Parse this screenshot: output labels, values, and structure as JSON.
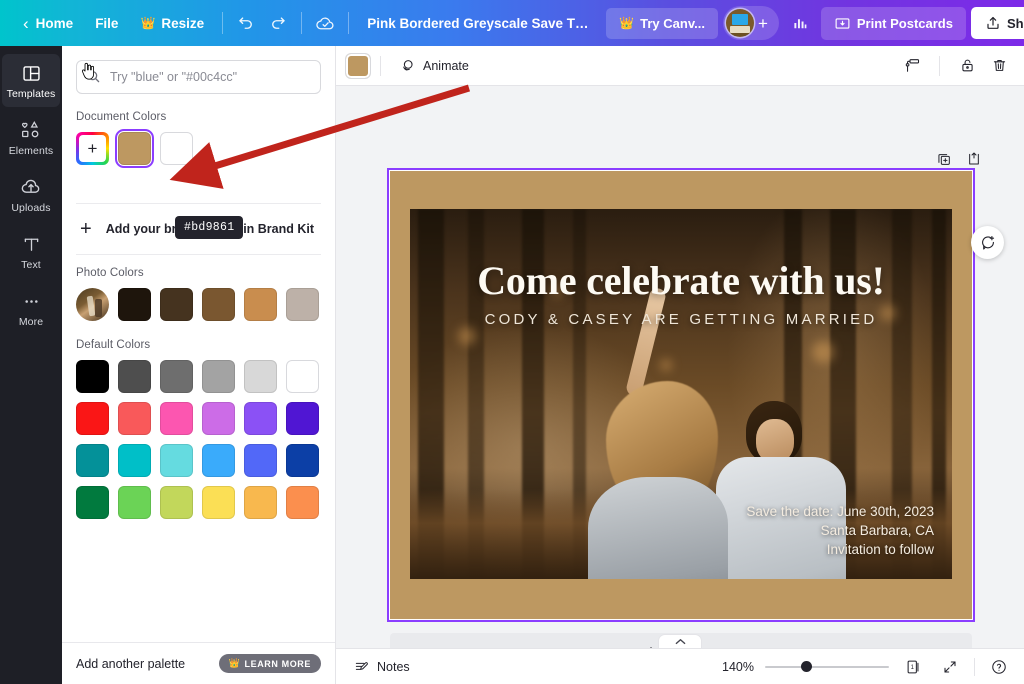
{
  "topbar": {
    "back_icon": "chevron-left-icon",
    "home_label": "Home",
    "file_label": "File",
    "resize_label": "Resize",
    "resize_icon": "crown-icon",
    "undo_icon": "undo-icon",
    "redo_icon": "redo-icon",
    "cloud_icon": "cloud-saved-icon",
    "doc_title": "Pink Bordered Greyscale Save The Date P...",
    "try_canva_label": "Try Canv...",
    "try_canva_icon": "crown-icon",
    "avatar_icon": "user-avatar",
    "add_collaborator_icon": "plus-icon",
    "insights_icon": "bar-chart-icon",
    "print_label": "Print Postcards",
    "print_icon": "print-postcard-icon",
    "share_label": "Share",
    "share_icon": "upload-share-icon"
  },
  "rail": {
    "items": [
      {
        "label": "Templates",
        "icon": "templates-grid-icon",
        "active": true
      },
      {
        "label": "Elements",
        "icon": "elements-shapes-icon",
        "active": false
      },
      {
        "label": "Uploads",
        "icon": "upload-cloud-icon",
        "active": false
      },
      {
        "label": "Text",
        "icon": "text-t-icon",
        "active": false
      },
      {
        "label": "More",
        "icon": "more-dots-icon",
        "active": false
      }
    ]
  },
  "panel": {
    "search": {
      "placeholder": "Try \"blue\" or \"#00c4cc\"",
      "value": "",
      "icon": "search-icon"
    },
    "document_colors": {
      "label": "Document Colors",
      "add_icon": "rainbow-plus-icon",
      "swatches": [
        {
          "name": "add-color",
          "color": "rainbow"
        },
        {
          "name": "tan",
          "color": "#bd9861",
          "selected": true
        },
        {
          "name": "white",
          "color": "#ffffff",
          "selected": false
        }
      ],
      "tooltip": "#bd9861",
      "cursor_icon": "hand-pointer-icon"
    },
    "brand_kit": {
      "label": "Add your brand colors in Brand Kit",
      "icon": "plus-icon"
    },
    "photo_colors": {
      "label": "Photo Colors",
      "thumbnail_icon": "photo-thumbnail",
      "swatches": [
        "#1e150c",
        "#473venue",
        "#45331f",
        "#7a5730",
        "#c98d4e",
        "#bdb1a8"
      ]
    },
    "default_colors": {
      "label": "Default Colors",
      "rows": [
        [
          "#000000",
          "#4e4e4e",
          "#6e6e6e",
          "#a3a3a3",
          "#d8d8d8",
          "#ffffff"
        ],
        [
          "#fa1616",
          "#f9595a",
          "#fc56b0",
          "#cc6ce7",
          "#8b51f5",
          "#5016d3"
        ],
        [
          "#049199",
          "#00bfc8",
          "#65dbe0",
          "#3aabfb",
          "#5268f8",
          "#0c3fa6"
        ],
        [
          "#017a3e",
          "#6bd356",
          "#c2d75b",
          "#fbdf55",
          "#f8b84e",
          "#fb8f4e"
        ]
      ]
    },
    "footer": {
      "add_palette_label": "Add another palette",
      "learn_more_label": "LEARN MORE",
      "learn_more_icon": "crown-icon"
    }
  },
  "context_bar": {
    "color_swatch": "#bd9861",
    "animate_label": "Animate",
    "animate_icon": "animate-circles-icon",
    "paint_roller_icon": "paint-roller-icon",
    "lock_icon": "lock-open-icon",
    "trash_icon": "trash-icon"
  },
  "page_tools": {
    "duplicate_icon": "duplicate-page-icon",
    "add_to_folder_icon": "add-page-icon"
  },
  "comment_fab": {
    "icon": "add-comment-icon"
  },
  "design": {
    "frame_color": "#bd9861",
    "selection_color": "#8b3dff",
    "headline": "Come celebrate with us!",
    "subheadline": "CODY & CASEY ARE GETTING MARRIED",
    "detail_lines": [
      "Save the date: June 30th, 2023",
      "Santa Barbara, CA",
      "Invitation to follow"
    ]
  },
  "add_page": {
    "label": "+ Add page"
  },
  "bottombar": {
    "notes_label": "Notes",
    "notes_icon": "notes-icon",
    "zoom_level": "140%",
    "page_count": "1",
    "page_icon": "page-count-icon",
    "fullscreen_icon": "expand-icon",
    "help_icon": "help-question-icon",
    "collapse_icon": "chevron-up-icon"
  },
  "annotation": {
    "arrow_color": "#c0241c"
  }
}
